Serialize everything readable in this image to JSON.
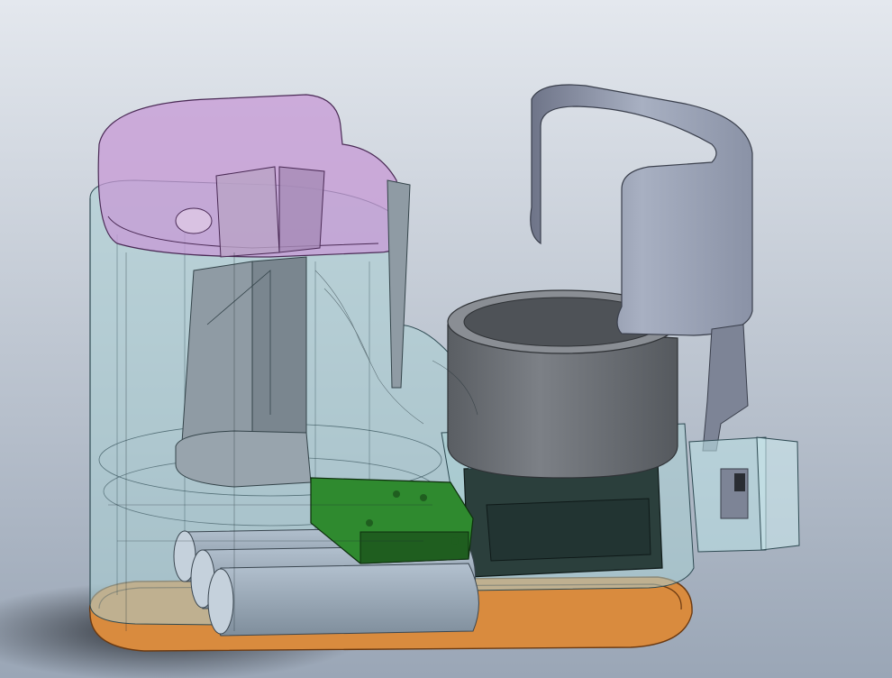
{
  "viewport": {
    "background_top": "#e4e8ee",
    "background_bottom": "#9aa6b6"
  },
  "colors": {
    "housing_shell": "#a9cfd3",
    "housing_edge": "#2e4a52",
    "top_cap": "#c79ad6",
    "base_plate": "#d98b3e",
    "base_edge": "#6b3a12",
    "pcb": "#2f8a2f",
    "pcb_dark": "#1f5e1f",
    "motor_block": "#2b3f3c",
    "batteries": "#9aa9b8",
    "bracket": "#8f9ba4",
    "cup_body": "#6f7378",
    "cup_rim": "#8a8e94",
    "cup_inner": "#4e5257",
    "clamp": "#a6aec0",
    "clamp_dark": "#7d8496",
    "small_block": "#b9dde3"
  },
  "parts": [
    {
      "name": "cylindrical-housing",
      "icon": "translucent-shell"
    },
    {
      "name": "top-cap",
      "icon": "purple-cap"
    },
    {
      "name": "base-plate",
      "icon": "orange-base"
    },
    {
      "name": "battery-pack",
      "icon": "cylinders"
    },
    {
      "name": "circuit-board",
      "icon": "green-pcb"
    },
    {
      "name": "servo-motor",
      "icon": "motor-block"
    },
    {
      "name": "motor-bracket",
      "icon": "bracket"
    },
    {
      "name": "cup-holder",
      "icon": "cylinder-cup"
    },
    {
      "name": "curved-clamp",
      "icon": "clamp"
    },
    {
      "name": "sensor-block",
      "icon": "small-box"
    }
  ]
}
